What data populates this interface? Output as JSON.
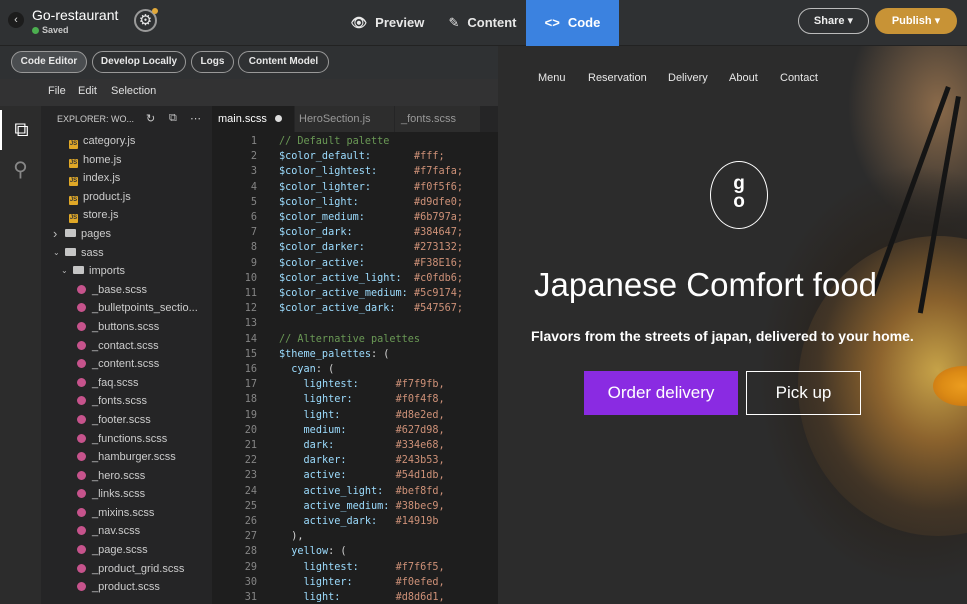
{
  "topbar": {
    "back_icon": "chevron-left-icon",
    "site_name": "Go-restaurant",
    "status": "Saved",
    "status_color": "#4caf50",
    "settings_icon": "gear-icon",
    "modes": [
      {
        "label": "Preview",
        "icon": "eye-icon"
      },
      {
        "label": "Content",
        "icon": "pencil-icon"
      },
      {
        "label": "Code",
        "icon": "code-icon",
        "active": true
      }
    ],
    "share_label": "Share ▾",
    "publish_label": "Publish ▾",
    "accent_color": "#3b82e0",
    "publish_color": "#c89336"
  },
  "toolbar": {
    "buttons": [
      "Code Editor",
      "Develop Locally",
      "Logs",
      "Content Model"
    ],
    "active": "Code Editor"
  },
  "menubar": [
    "File",
    "Edit",
    "Selection"
  ],
  "explorer": {
    "title": "EXPLORER: WO...",
    "tree": [
      {
        "name": "category.js",
        "type": "js"
      },
      {
        "name": "home.js",
        "type": "js"
      },
      {
        "name": "index.js",
        "type": "js"
      },
      {
        "name": "product.js",
        "type": "js"
      },
      {
        "name": "store.js",
        "type": "js"
      },
      {
        "name": "pages",
        "type": "folder",
        "open": false
      },
      {
        "name": "sass",
        "type": "folder",
        "open": true
      },
      {
        "name": "imports",
        "type": "folder",
        "open": true
      },
      {
        "name": "_base.scss",
        "type": "scss"
      },
      {
        "name": "_bulletpoints_sectio...",
        "type": "scss"
      },
      {
        "name": "_buttons.scss",
        "type": "scss"
      },
      {
        "name": "_contact.scss",
        "type": "scss"
      },
      {
        "name": "_content.scss",
        "type": "scss"
      },
      {
        "name": "_faq.scss",
        "type": "scss"
      },
      {
        "name": "_fonts.scss",
        "type": "scss"
      },
      {
        "name": "_footer.scss",
        "type": "scss"
      },
      {
        "name": "_functions.scss",
        "type": "scss"
      },
      {
        "name": "_hamburger.scss",
        "type": "scss"
      },
      {
        "name": "_hero.scss",
        "type": "scss"
      },
      {
        "name": "_links.scss",
        "type": "scss"
      },
      {
        "name": "_mixins.scss",
        "type": "scss"
      },
      {
        "name": "_nav.scss",
        "type": "scss"
      },
      {
        "name": "_page.scss",
        "type": "scss"
      },
      {
        "name": "_product_grid.scss",
        "type": "scss"
      },
      {
        "name": "_product.scss",
        "type": "scss"
      }
    ]
  },
  "tabs": [
    {
      "label": "main.scss",
      "active": true,
      "dirty": true
    },
    {
      "label": "HeroSection.js",
      "active": false
    },
    {
      "label": "_fonts.scss",
      "active": false
    }
  ],
  "code": [
    {
      "n": "1",
      "parts": [
        [
          "cmt",
          "// Default palette"
        ]
      ]
    },
    {
      "n": "2",
      "parts": [
        [
          "var",
          "$color_default:       "
        ],
        [
          "val",
          "#fff;"
        ]
      ]
    },
    {
      "n": "3",
      "parts": [
        [
          "var",
          "$color_lightest:      "
        ],
        [
          "val",
          "#f7fafa;"
        ]
      ]
    },
    {
      "n": "4",
      "parts": [
        [
          "var",
          "$color_lighter:       "
        ],
        [
          "val",
          "#f0f5f6;"
        ]
      ]
    },
    {
      "n": "5",
      "parts": [
        [
          "var",
          "$color_light:         "
        ],
        [
          "val",
          "#d9dfe0;"
        ]
      ]
    },
    {
      "n": "6",
      "parts": [
        [
          "var",
          "$color_medium:        "
        ],
        [
          "val",
          "#6b797a;"
        ]
      ]
    },
    {
      "n": "7",
      "parts": [
        [
          "var",
          "$color_dark:          "
        ],
        [
          "val",
          "#384647;"
        ]
      ]
    },
    {
      "n": "8",
      "parts": [
        [
          "var",
          "$color_darker:        "
        ],
        [
          "val",
          "#273132;"
        ]
      ]
    },
    {
      "n": "9",
      "parts": [
        [
          "var",
          "$color_active:        "
        ],
        [
          "val",
          "#F38E16;"
        ]
      ]
    },
    {
      "n": "10",
      "parts": [
        [
          "var",
          "$color_active_light:  "
        ],
        [
          "val",
          "#c0fdb6;"
        ]
      ]
    },
    {
      "n": "11",
      "parts": [
        [
          "var",
          "$color_active_medium: "
        ],
        [
          "val",
          "#5c9174;"
        ]
      ]
    },
    {
      "n": "12",
      "parts": [
        [
          "var",
          "$color_active_dark:   "
        ],
        [
          "val",
          "#547567;"
        ]
      ]
    },
    {
      "n": "13",
      "parts": []
    },
    {
      "n": "14",
      "parts": [
        [
          "cmt",
          "// Alternative palettes"
        ]
      ]
    },
    {
      "n": "15",
      "parts": [
        [
          "var",
          "$theme_palettes"
        ],
        [
          "plain",
          ": ("
        ]
      ]
    },
    {
      "n": "16",
      "parts": [
        [
          "plain",
          "  "
        ],
        [
          "var",
          "cyan"
        ],
        [
          "plain",
          ": ("
        ]
      ]
    },
    {
      "n": "17",
      "parts": [
        [
          "plain",
          "    "
        ],
        [
          "var",
          "lightest:      "
        ],
        [
          "val",
          "#f7f9fb,"
        ]
      ]
    },
    {
      "n": "18",
      "parts": [
        [
          "plain",
          "    "
        ],
        [
          "var",
          "lighter:       "
        ],
        [
          "val",
          "#f0f4f8,"
        ]
      ]
    },
    {
      "n": "19",
      "parts": [
        [
          "plain",
          "    "
        ],
        [
          "var",
          "light:         "
        ],
        [
          "val",
          "#d8e2ed,"
        ]
      ]
    },
    {
      "n": "20",
      "parts": [
        [
          "plain",
          "    "
        ],
        [
          "var",
          "medium:        "
        ],
        [
          "val",
          "#627d98,"
        ]
      ]
    },
    {
      "n": "21",
      "parts": [
        [
          "plain",
          "    "
        ],
        [
          "var",
          "dark:          "
        ],
        [
          "val",
          "#334e68,"
        ]
      ]
    },
    {
      "n": "22",
      "parts": [
        [
          "plain",
          "    "
        ],
        [
          "var",
          "darker:        "
        ],
        [
          "val",
          "#243b53,"
        ]
      ]
    },
    {
      "n": "23",
      "parts": [
        [
          "plain",
          "    "
        ],
        [
          "var",
          "active:        "
        ],
        [
          "val",
          "#54d1db,"
        ]
      ]
    },
    {
      "n": "24",
      "parts": [
        [
          "plain",
          "    "
        ],
        [
          "var",
          "active_light:  "
        ],
        [
          "val",
          "#bef8fd,"
        ]
      ]
    },
    {
      "n": "25",
      "parts": [
        [
          "plain",
          "    "
        ],
        [
          "var",
          "active_medium: "
        ],
        [
          "val",
          "#38bec9,"
        ]
      ]
    },
    {
      "n": "26",
      "parts": [
        [
          "plain",
          "    "
        ],
        [
          "var",
          "active_dark:   "
        ],
        [
          "val",
          "#14919b"
        ]
      ]
    },
    {
      "n": "27",
      "parts": [
        [
          "plain",
          "  ),"
        ]
      ]
    },
    {
      "n": "28",
      "parts": [
        [
          "plain",
          "  "
        ],
        [
          "var",
          "yellow"
        ],
        [
          "plain",
          ": ("
        ]
      ]
    },
    {
      "n": "29",
      "parts": [
        [
          "plain",
          "    "
        ],
        [
          "var",
          "lightest:      "
        ],
        [
          "val",
          "#f7f6f5,"
        ]
      ]
    },
    {
      "n": "30",
      "parts": [
        [
          "plain",
          "    "
        ],
        [
          "var",
          "lighter:       "
        ],
        [
          "val",
          "#f0efed,"
        ]
      ]
    },
    {
      "n": "31",
      "parts": [
        [
          "plain",
          "    "
        ],
        [
          "var",
          "light:         "
        ],
        [
          "val",
          "#d8d6d1,"
        ]
      ]
    }
  ],
  "preview": {
    "nav": [
      "Menu",
      "Reservation",
      "Delivery",
      "About",
      "Contact"
    ],
    "logo_text": "go",
    "title": "Japanese Comfort food",
    "subtitle": "Flavors from the streets of japan, delivered to your home.",
    "primary_cta": "Order delivery",
    "secondary_cta": "Pick up",
    "cta_color": "#8a2be2"
  }
}
